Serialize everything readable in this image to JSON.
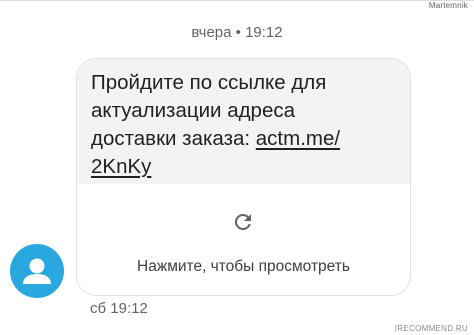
{
  "header": {
    "watermark": "Martemnik",
    "timestamp": "вчера • 19:12"
  },
  "message": {
    "text_lines": [
      "Пройдите по ссылке для",
      "актуализации адреса",
      "доставки заказа: "
    ],
    "link_part1": "actm.me/",
    "link_part2": "2KnKy",
    "link_preview": {
      "icon": "refresh-icon",
      "label": "Нажмите, чтобы просмотреть"
    }
  },
  "sender": {
    "avatar_icon": "person-icon",
    "avatar_color": "#29a8e0"
  },
  "footer": {
    "timestamp": "сб 19:12",
    "watermark": "IRECOMMEND.RU"
  }
}
